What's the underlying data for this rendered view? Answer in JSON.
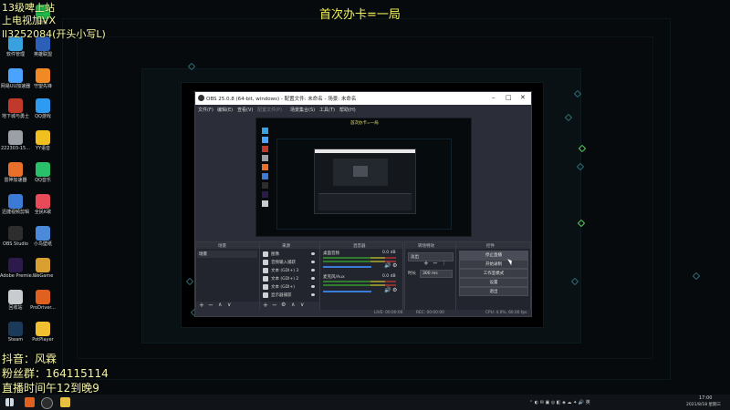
{
  "colors": {
    "headline": "#f3f35a",
    "overlay": "#f5f5a2",
    "accent": "#3a7bd5"
  },
  "headline": "首次办卡=一局",
  "overlay_top": [
    "13级啤上站",
    "上电视加VX",
    "ll3252084(开头小写L)"
  ],
  "overlay_bottom": [
    "抖音：风霖",
    "粉丝群：164115114",
    "直播时间午12到晚9"
  ],
  "desktop_icons": [
    {
      "label": "软件管理",
      "icon": "app-manager-icon",
      "color": "#3aa1e0"
    },
    {
      "label": "网易UU加速器",
      "icon": "uu-booster-icon",
      "color": "#4aa3ff"
    },
    {
      "label": "地下城与勇士",
      "icon": "dnf-icon",
      "color": "#c0392b"
    },
    {
      "label": "222303-15...",
      "icon": "file-icon",
      "color": "#9aa0a6"
    },
    {
      "label": "雷神加速器",
      "icon": "leishen-icon",
      "color": "#e8702a"
    },
    {
      "label": "迅捷视频剪辑",
      "icon": "video-edit-icon",
      "color": "#3d7ad6"
    },
    {
      "label": "OBS Studio",
      "icon": "obs-icon",
      "color": "#2d2d2d"
    },
    {
      "label": "Adobe Premie...",
      "icon": "premiere-icon",
      "color": "#2b1a4a"
    },
    {
      "label": "回收站",
      "icon": "recycle-bin-icon",
      "color": "#c8ccd0"
    },
    {
      "label": "Steam",
      "icon": "steam-icon",
      "color": "#1b3a5a"
    },
    {
      "label": "微信",
      "icon": "wechat-icon",
      "color": "#22b84a"
    },
    {
      "label": "英雄联盟",
      "icon": "lol-icon",
      "color": "#2b5fb8"
    },
    {
      "label": "守望先锋",
      "icon": "overwatch-icon",
      "color": "#f08a24"
    },
    {
      "label": "QQ游戏",
      "icon": "qq-game-icon",
      "color": "#2d9bf0"
    },
    {
      "label": "YY语音",
      "icon": "yy-icon",
      "color": "#f0c020"
    },
    {
      "label": "QQ音乐",
      "icon": "qq-music-icon",
      "color": "#2ac06a"
    },
    {
      "label": "全民K歌",
      "icon": "karaoke-icon",
      "color": "#e84a5a"
    },
    {
      "label": "小鸟壁纸",
      "icon": "wallpaper-icon",
      "color": "#4a8ad8"
    },
    {
      "label": "WeGame",
      "icon": "wegame-icon",
      "color": "#d8a030"
    },
    {
      "label": "ProDriver...",
      "icon": "prodriver-icon",
      "color": "#e06020"
    },
    {
      "label": "PotPlayer",
      "icon": "potplayer-icon",
      "color": "#f0c030"
    }
  ],
  "obs": {
    "title": "OBS 25.0.8 (64-bit, windows) - 配置文件: 未命名 - 场景: 未命名",
    "menu": [
      "文件(F)",
      "编辑(E)",
      "查看(V)",
      "配置文件(P)",
      "场景集合(S)",
      "工具(T)",
      "帮助(H)"
    ],
    "preview_title": "首次办卡=一局",
    "panels": {
      "scenes": "场景",
      "sources": "来源",
      "mixer": "混音器",
      "transitions": "转场特效",
      "controls": "控件"
    },
    "scene_items": [
      "场景"
    ],
    "sources": [
      "图像",
      "音频输入捕获",
      "文本 (GDI+) 3",
      "文本 (GDI+) 2",
      "文本 (GDI+)",
      "显示器捕获"
    ],
    "mixer": [
      {
        "name": "桌面音频",
        "db": "0.0 dB",
        "level": 0.85
      },
      {
        "name": "麦克风/Aux",
        "db": "0.0 dB",
        "level": 0.85
      }
    ],
    "transition": {
      "type": "淡出",
      "duration_label": "时长",
      "duration": "300 ms"
    },
    "controls": [
      "停止直播",
      "开始录制",
      "工作室模式",
      "设置",
      "退出"
    ],
    "status": {
      "live": "LIVE: 00:00:00",
      "rec": "REC: 00:00:00",
      "cpu": "CPU: 4.0%, 60.00 fps"
    }
  },
  "taskbar": {
    "clock_time": "17:00",
    "clock_date": "2021/8/18 星期三"
  }
}
